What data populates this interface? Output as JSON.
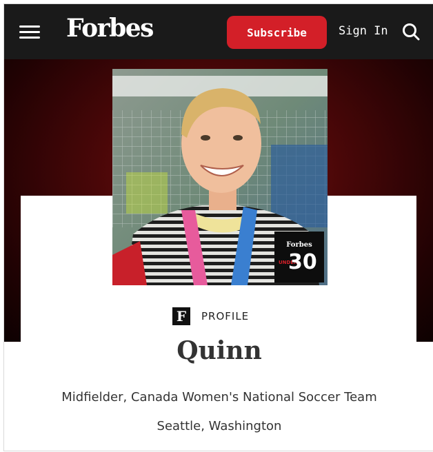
{
  "header": {
    "logo_text": "Forbes",
    "subscribe_label": "Subscribe",
    "signin_label": "Sign In"
  },
  "badge": {
    "brand": "Forbes",
    "under": "UNDER",
    "number": "30"
  },
  "profile": {
    "tag": "PROFILE",
    "f_letter": "F",
    "name": "Quinn",
    "role": "Midfielder, Canada Women's National Soccer Team",
    "location": "Seattle, Washington"
  },
  "colors": {
    "header_bg": "#1a1a1a",
    "accent_red": "#d31f28",
    "hero_dark_red": "#4a0708"
  },
  "icons": [
    "hamburger-menu-icon",
    "search-icon",
    "forbes-f-icon"
  ]
}
